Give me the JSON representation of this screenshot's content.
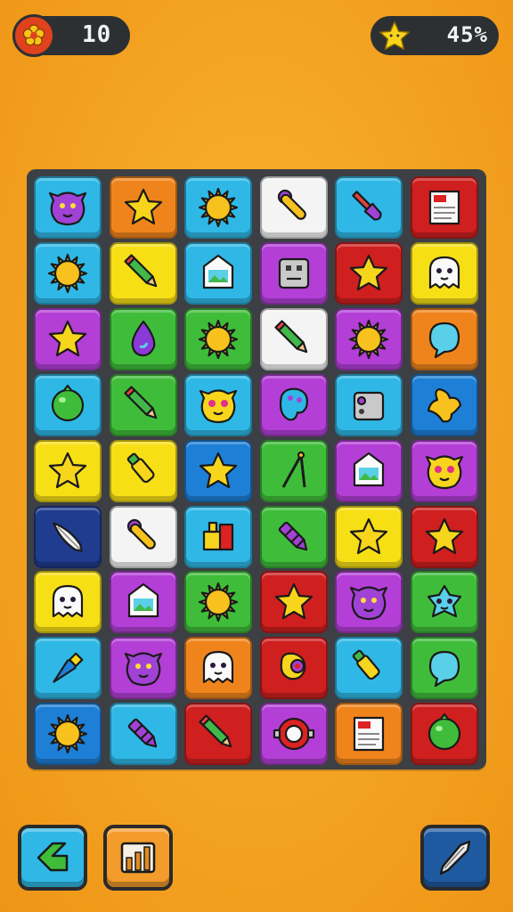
{
  "hud": {
    "coins": "10",
    "progress": "45%",
    "coin_icon": "flower-coin-icon",
    "progress_icon": "star-icon"
  },
  "colors": {
    "background": "#f4a322",
    "board": "#3c3f44",
    "tile_palette": {
      "cyan": "#2fb8e6",
      "orange": "#f0841c",
      "red": "#cf1f1f",
      "white": "#f4f4f4",
      "yellow": "#f7df16",
      "purple": "#b33fd6",
      "green": "#3fbd3a",
      "blue": "#1e7fd6",
      "navy": "#1f3c8f"
    }
  },
  "board": {
    "rows": 9,
    "cols": 6,
    "tiles": [
      [
        {
          "bg": "cyan",
          "icon": "purple-monster"
        },
        {
          "bg": "orange",
          "icon": "star"
        },
        {
          "bg": "cyan",
          "icon": "sun"
        },
        {
          "bg": "white",
          "icon": "paint-roller"
        },
        {
          "bg": "cyan",
          "icon": "paintbrush"
        },
        {
          "bg": "red",
          "icon": "document"
        }
      ],
      [
        {
          "bg": "cyan",
          "icon": "sun"
        },
        {
          "bg": "yellow",
          "icon": "pencil"
        },
        {
          "bg": "cyan",
          "icon": "picture-frame"
        },
        {
          "bg": "purple",
          "icon": "robot-box"
        },
        {
          "bg": "red",
          "icon": "star"
        },
        {
          "bg": "yellow",
          "icon": "ghost"
        }
      ],
      [
        {
          "bg": "purple",
          "icon": "star"
        },
        {
          "bg": "green",
          "icon": "water-drop"
        },
        {
          "bg": "green",
          "icon": "sun"
        },
        {
          "bg": "white",
          "icon": "pencil"
        },
        {
          "bg": "purple",
          "icon": "sun"
        },
        {
          "bg": "orange",
          "icon": "speech-bubble"
        }
      ],
      [
        {
          "bg": "cyan",
          "icon": "green-ball"
        },
        {
          "bg": "green",
          "icon": "pencil"
        },
        {
          "bg": "cyan",
          "icon": "yellow-monster"
        },
        {
          "bg": "purple",
          "icon": "paint-palette"
        },
        {
          "bg": "cyan",
          "icon": "camera-box"
        },
        {
          "bg": "blue",
          "icon": "blob"
        }
      ],
      [
        {
          "bg": "yellow",
          "icon": "star"
        },
        {
          "bg": "yellow",
          "icon": "marker"
        },
        {
          "bg": "blue",
          "icon": "star"
        },
        {
          "bg": "green",
          "icon": "compass"
        },
        {
          "bg": "purple",
          "icon": "picture-frame"
        },
        {
          "bg": "purple",
          "icon": "yellow-monster"
        }
      ],
      [
        {
          "bg": "navy",
          "icon": "feather-quill"
        },
        {
          "bg": "white",
          "icon": "paint-roller"
        },
        {
          "bg": "cyan",
          "icon": "paint-set"
        },
        {
          "bg": "green",
          "icon": "crayon"
        },
        {
          "bg": "yellow",
          "icon": "star"
        },
        {
          "bg": "red",
          "icon": "star"
        }
      ],
      [
        {
          "bg": "yellow",
          "icon": "ghost"
        },
        {
          "bg": "purple",
          "icon": "picture-frame"
        },
        {
          "bg": "green",
          "icon": "sun"
        },
        {
          "bg": "red",
          "icon": "star"
        },
        {
          "bg": "purple",
          "icon": "purple-monster"
        },
        {
          "bg": "green",
          "icon": "star-monster"
        }
      ],
      [
        {
          "bg": "cyan",
          "icon": "pen-nib"
        },
        {
          "bg": "purple",
          "icon": "purple-monster"
        },
        {
          "bg": "orange",
          "icon": "ghost"
        },
        {
          "bg": "red",
          "icon": "paint-tube"
        },
        {
          "bg": "cyan",
          "icon": "marker"
        },
        {
          "bg": "green",
          "icon": "speech-bubble"
        }
      ],
      [
        {
          "bg": "blue",
          "icon": "sun"
        },
        {
          "bg": "cyan",
          "icon": "crayon"
        },
        {
          "bg": "red",
          "icon": "pencil"
        },
        {
          "bg": "purple",
          "icon": "tape-roll"
        },
        {
          "bg": "orange",
          "icon": "document"
        },
        {
          "bg": "red",
          "icon": "green-ball"
        }
      ]
    ]
  },
  "toolbar": {
    "left": [
      {
        "name": "back-button",
        "icon": "chevron-left-icon"
      },
      {
        "name": "stats-button",
        "icon": "bar-chart-icon"
      }
    ],
    "right": [
      {
        "name": "tool-button",
        "icon": "quill-icon"
      }
    ]
  }
}
